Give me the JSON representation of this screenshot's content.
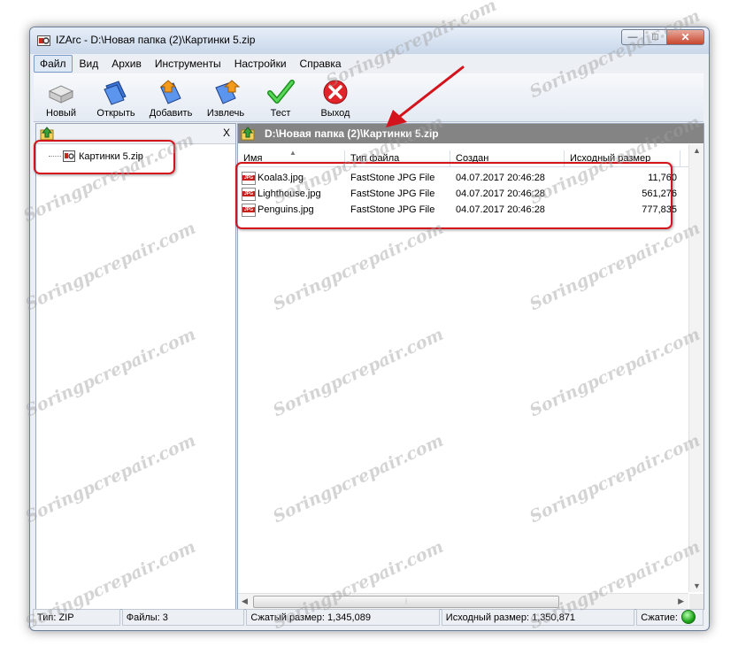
{
  "window": {
    "title": "IZArc - D:\\Новая папка (2)\\Картинки 5.zip",
    "caption_min": "—",
    "caption_max": "□",
    "caption_close": "✕"
  },
  "menu": [
    {
      "label": "Файл"
    },
    {
      "label": "Вид"
    },
    {
      "label": "Архив"
    },
    {
      "label": "Инструменты"
    },
    {
      "label": "Настройки"
    },
    {
      "label": "Справка"
    }
  ],
  "toolbar": [
    {
      "label": "Новый",
      "icon": "new-archive-icon"
    },
    {
      "label": "Открыть",
      "icon": "open-folder-icon"
    },
    {
      "label": "Добавить",
      "icon": "add-icon"
    },
    {
      "label": "Извлечь",
      "icon": "extract-icon"
    },
    {
      "label": "Тест",
      "icon": "checkmark-icon"
    },
    {
      "label": "Выход",
      "icon": "exit-icon"
    }
  ],
  "tree": {
    "close": "X",
    "item": "Картинки 5.zip"
  },
  "path": "D:\\Новая папка (2)\\Картинки 5.zip",
  "columns": {
    "name": "Имя",
    "type": "Тип файла",
    "created": "Создан",
    "size": "Исходный размер"
  },
  "files": [
    {
      "name": "Koala3.jpg",
      "type": "FastStone JPG File",
      "created": "04.07.2017 20:46:28",
      "size": "11,760"
    },
    {
      "name": "Lighthouse.jpg",
      "type": "FastStone JPG File",
      "created": "04.07.2017 20:46:28",
      "size": "561,276"
    },
    {
      "name": "Penguins.jpg",
      "type": "FastStone JPG File",
      "created": "04.07.2017 20:46:28",
      "size": "777,835"
    }
  ],
  "file_icon_text": "JPG",
  "status": {
    "type": "Тип: ZIP",
    "files": "Файлы: 3",
    "compressed": "Сжатый размер: 1,345,089",
    "original": "Исходный размер: 1,350,871",
    "compression": "Сжатие:"
  },
  "watermark": "Soringpcrepair.com",
  "colors": {
    "annotation": "#d4141c",
    "path_bar": "#848484",
    "status_led": "#1ea51a"
  }
}
